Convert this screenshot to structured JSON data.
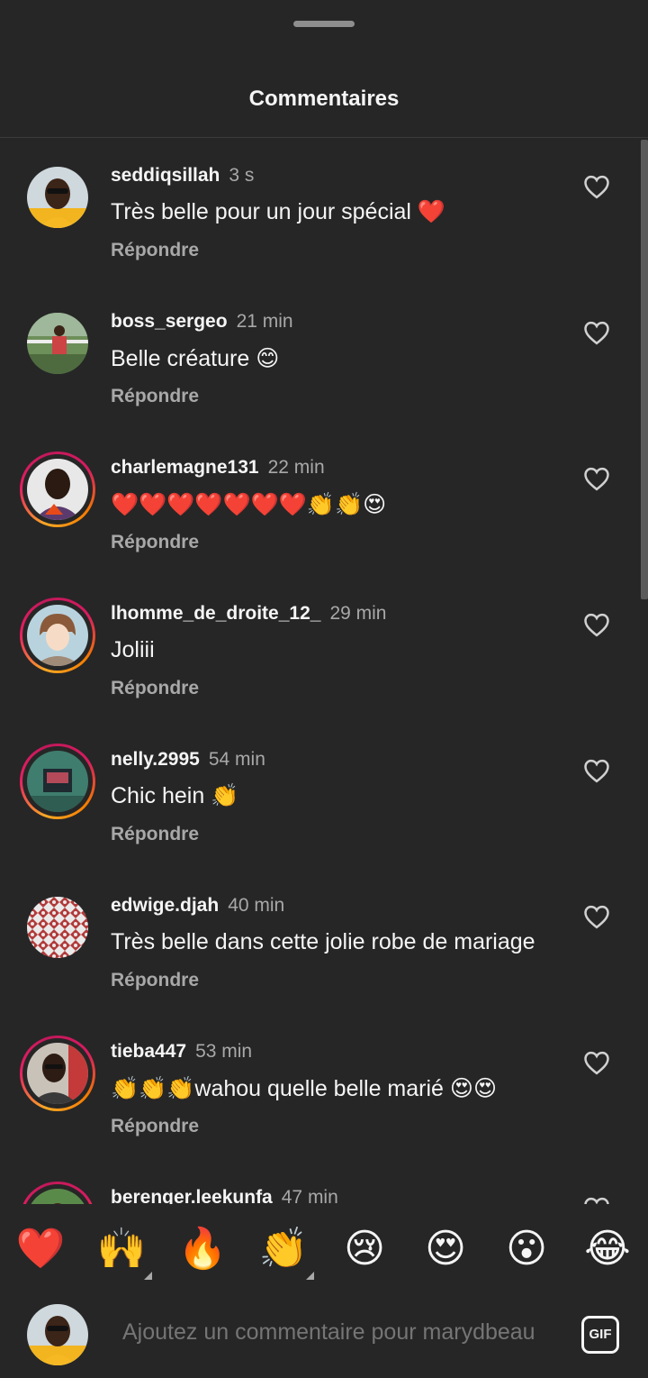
{
  "header": {
    "title": "Commentaires"
  },
  "comments": [
    {
      "username": "seddiqsillah",
      "time": "3 s",
      "text": "Très belle pour un jour spécial ❤️",
      "reply": "Répondre"
    },
    {
      "username": "boss_sergeo",
      "time": "21 min",
      "text": "Belle créature 😊",
      "reply": "Répondre"
    },
    {
      "username": "charlemagne131",
      "time": "22 min",
      "text": "❤️❤️❤️❤️❤️❤️❤️👏👏😍",
      "reply": "Répondre"
    },
    {
      "username": "lhomme_de_droite_12_",
      "time": "29 min",
      "text": "Joliii",
      "reply": "Répondre"
    },
    {
      "username": "nelly.2995",
      "time": "54 min",
      "text": "Chic hein 👏",
      "reply": "Répondre"
    },
    {
      "username": "edwige.djah",
      "time": "40 min",
      "text": "Très belle dans cette jolie robe de mariage",
      "reply": "Répondre"
    },
    {
      "username": "tieba447",
      "time": "53 min",
      "text": "👏👏👏wahou quelle belle marié 😍😍",
      "reply": "Répondre"
    },
    {
      "username": "berenger.leekunfa",
      "time": "47 min",
      "text": "",
      "reply": ""
    }
  ],
  "reactions": [
    "❤️",
    "🙌",
    "🔥",
    "👏",
    "😢",
    "😍",
    "😮",
    "😂"
  ],
  "composer": {
    "placeholder": "Ajoutez un commentaire pour marydbeau",
    "gif_label": "GIF"
  },
  "icons": {
    "like": "heart-outline-icon",
    "gif": "gif-icon"
  },
  "colors": {
    "background": "#262626",
    "secondary_text": "#a8a8a8",
    "primary_text": "#f5f5f5"
  }
}
